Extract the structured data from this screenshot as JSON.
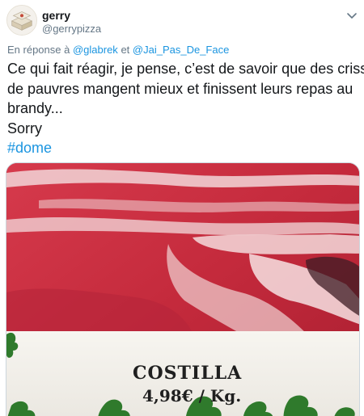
{
  "tweet": {
    "display_name": "gerry",
    "handle": "@gerrypizza",
    "reply": {
      "prefix": "En réponse à",
      "user1": "@glabrek",
      "separator": "et",
      "user2": "@Jai_Pas_De_Face"
    },
    "text_lines": [
      "Ce qui fait réagir, je pense, c’est de savoir que des criss",
      "de pauvres mangent mieux et finissent leurs repas au",
      "brandy...",
      "Sorry"
    ],
    "hashtag": "#dome",
    "media": {
      "label_name": "COSTILLA",
      "label_price": "4,98€ / Kg."
    }
  },
  "icons": {
    "avatar": "pizza-box-avatar",
    "menu": "chevron-down-icon"
  },
  "colors": {
    "link": "#1b95e0",
    "secondary": "#657786",
    "text": "#14171a"
  }
}
